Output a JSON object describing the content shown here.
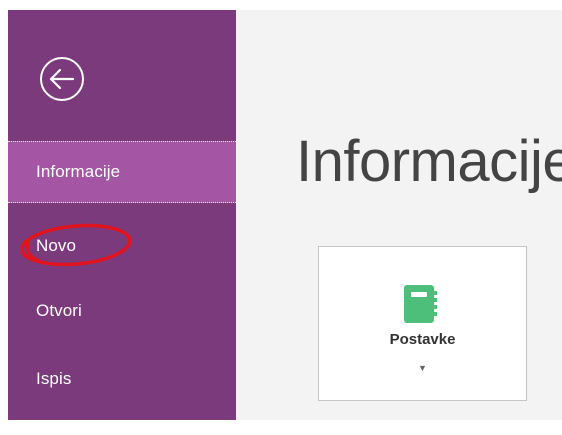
{
  "sidebar": {
    "back_icon": "arrow-left-circle-icon",
    "items": [
      {
        "label": "Informacije",
        "active": true
      },
      {
        "label": "Novo",
        "active": false
      },
      {
        "label": "Otvori",
        "active": false
      },
      {
        "label": "Ispis",
        "active": false
      }
    ]
  },
  "main": {
    "title": "Informacije",
    "settings_tile": {
      "label": "Postavke",
      "icon": "notebook-icon",
      "dropdown_icon": "chevron-down-icon"
    }
  },
  "colors": {
    "sidebar_bg": "#7b3a7c",
    "sidebar_active_bg": "#a456a4",
    "main_bg": "#f3f3f3",
    "notebook_green": "#4dbf7a",
    "annotation_red": "#e0141e"
  }
}
